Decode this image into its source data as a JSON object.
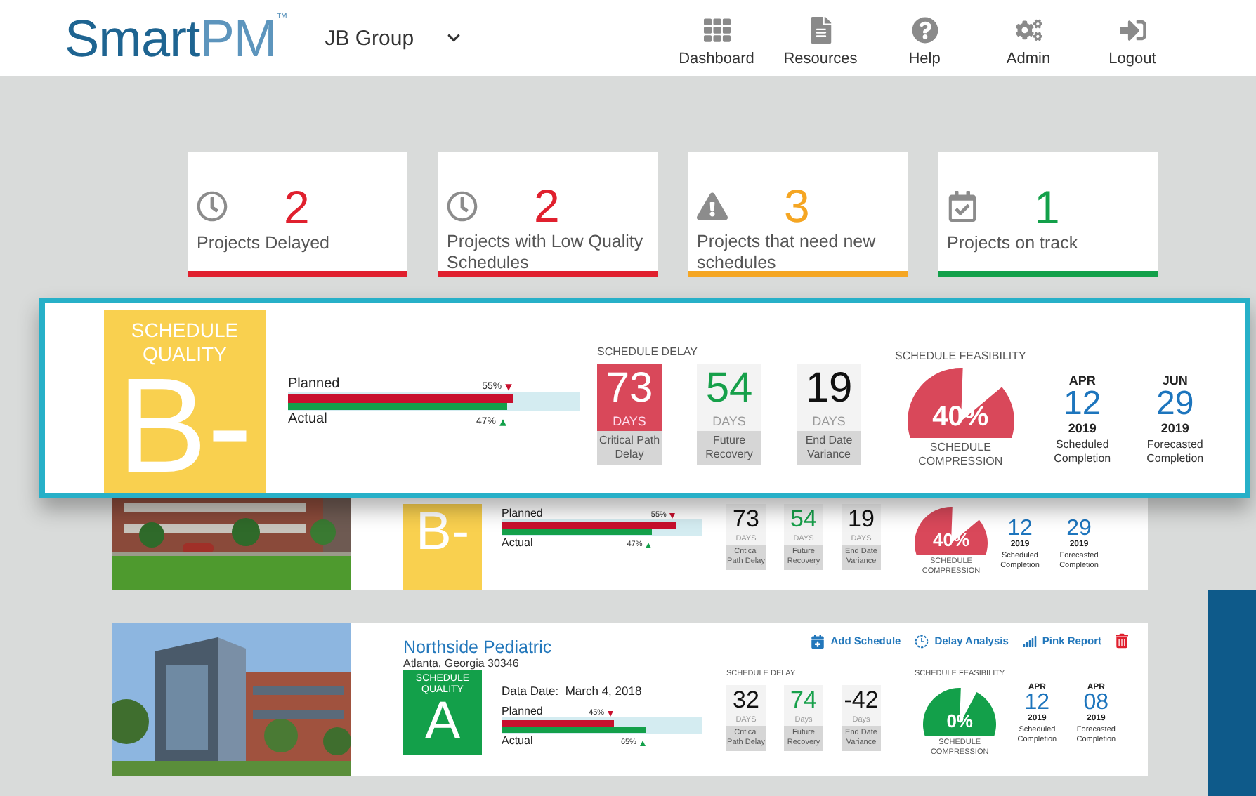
{
  "header": {
    "logo": {
      "primary": "Smart",
      "secondary": "PM",
      "trademark": "™"
    },
    "company": "JB Group",
    "nav": [
      {
        "label": "Dashboard"
      },
      {
        "label": "Resources"
      },
      {
        "label": "Help"
      },
      {
        "label": "Admin"
      },
      {
        "label": "Logout"
      }
    ]
  },
  "summary_cards": [
    {
      "count": "2",
      "label": "Projects Delayed",
      "color": "#e0202e"
    },
    {
      "count": "2",
      "label": "Projects with Low Quality Schedules",
      "color": "#e0202e"
    },
    {
      "count": "3",
      "label": "Projects that need new schedules",
      "color": "#f5a623"
    },
    {
      "count": "1",
      "label": "Projects on track",
      "color": "#13a04a"
    }
  ],
  "focused_project": {
    "grade": {
      "caption": "SCHEDULE QUALITY",
      "letter": "B-",
      "color": "#f9d04f"
    },
    "progress": {
      "planned": {
        "label": "Planned",
        "reading": "55%",
        "level": 0.77
      },
      "actual": {
        "label": "Actual",
        "reading": "47%",
        "level": 0.75
      }
    },
    "delay": {
      "heading": "SCHEDULE DELAY",
      "metrics": [
        {
          "value": "73",
          "unit": "DAYS",
          "caption": "Critical  Path Delay",
          "kind": "alert"
        },
        {
          "value": "54",
          "unit": "DAYS",
          "caption": "Future Recovery",
          "kind": "positive"
        },
        {
          "value": "19",
          "unit": "DAYS",
          "caption": "End Date Variance",
          "kind": "plain"
        }
      ]
    },
    "feasibility": {
      "heading": "SCHEDULE FEASIBILITY",
      "reading": "40%",
      "caption": "SCHEDULE COMPRESSION",
      "kind": "alert"
    },
    "dates": [
      {
        "month": "APR",
        "day": "12",
        "year": "2019",
        "caption": "Scheduled Completion"
      },
      {
        "month": "JUN",
        "day": "29",
        "year": "2019",
        "caption": "Forecasted Completion"
      }
    ]
  },
  "projects": [
    {
      "grade": {
        "letter": "B-",
        "color": "#f9d04f"
      },
      "progress": {
        "planned": {
          "label": "Planned",
          "reading": "55%",
          "level": 0.87
        },
        "actual": {
          "label": "Actual",
          "reading": "47%",
          "level": 0.75
        }
      },
      "delay": {
        "metrics": [
          {
            "value": "73",
            "unit": "DAYS",
            "caption": "Critical  Path Delay",
            "kind": "plain"
          },
          {
            "value": "54",
            "unit": "DAYS",
            "caption": "Future Recovery",
            "kind": "positive"
          },
          {
            "value": "19",
            "unit": "DAYS",
            "caption": "End Date Variance",
            "kind": "plain"
          }
        ]
      },
      "feasibility": {
        "reading": "40%",
        "caption": "SCHEDULE COMPRESSION",
        "kind": "alert"
      },
      "dates": [
        {
          "day": "12",
          "year": "2019",
          "caption": "Scheduled Completion"
        },
        {
          "day": "29",
          "year": "2019",
          "caption": "Forecasted Completion"
        }
      ]
    },
    {
      "title": "Northside Pediatric",
      "address": "Atlanta, Georgia 30346",
      "data_date": "Data Date:  March 4, 2018",
      "actions": [
        {
          "label": "Add Schedule"
        },
        {
          "label": "Delay Analysis"
        },
        {
          "label": "Pink Report"
        }
      ],
      "grade": {
        "caption": "SCHEDULE QUALITY",
        "letter": "A",
        "color": "#13a04a"
      },
      "progress": {
        "planned": {
          "label": "Planned",
          "reading": "45%",
          "level": 0.56
        },
        "actual": {
          "label": "Actual",
          "reading": "65%",
          "level": 0.72
        }
      },
      "delay": {
        "heading": "SCHEDULE DELAY",
        "metrics": [
          {
            "value": "32",
            "unit": "DAYS",
            "caption": "Critical  Path Delay",
            "kind": "plain"
          },
          {
            "value": "74",
            "unit": "Days",
            "caption": "Future Recovery",
            "kind": "positive"
          },
          {
            "value": "-42",
            "unit": "Days",
            "caption": "End Date Variance",
            "kind": "plain"
          }
        ]
      },
      "feasibility": {
        "heading": "SCHEDULE FEASIBILITY",
        "reading": "0%",
        "caption": "SCHEDULE COMPRESSION",
        "kind": "positive"
      },
      "dates": [
        {
          "month": "APR",
          "day": "12",
          "year": "2019",
          "caption": "Scheduled Completion"
        },
        {
          "month": "APR",
          "day": "08",
          "year": "2019",
          "caption": "Forecasted Completion"
        }
      ]
    }
  ]
}
